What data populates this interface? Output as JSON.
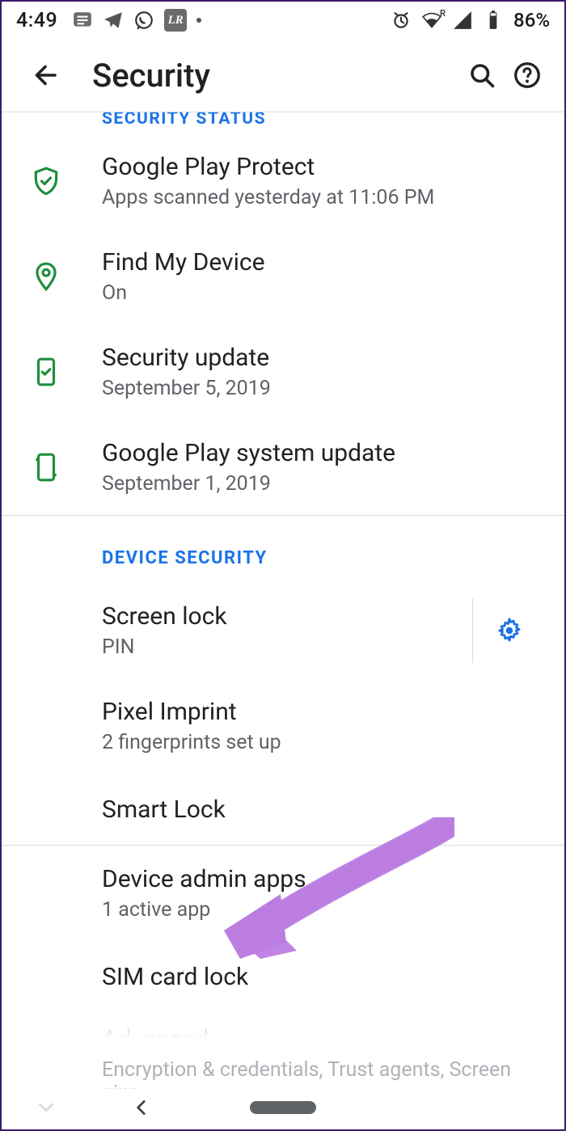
{
  "status": {
    "time": "4:49",
    "battery": "86%",
    "wifi_badge": "R"
  },
  "appbar": {
    "title": "Security"
  },
  "section_cut": "SECURITY STATUS",
  "rows": {
    "play_protect": {
      "title": "Google Play Protect",
      "subtitle": "Apps scanned yesterday at 11:06 PM"
    },
    "find_device": {
      "title": "Find My Device",
      "subtitle": "On"
    },
    "sec_update": {
      "title": "Security update",
      "subtitle": "September 5, 2019"
    },
    "sys_update": {
      "title": "Google Play system update",
      "subtitle": "September 1, 2019"
    }
  },
  "section2": "DEVICE SECURITY",
  "dev": {
    "screen_lock": {
      "title": "Screen lock",
      "subtitle": "PIN"
    },
    "imprint": {
      "title": "Pixel Imprint",
      "subtitle": "2 fingerprints set up"
    },
    "smart_lock": {
      "title": "Smart Lock"
    },
    "admin": {
      "title": "Device admin apps",
      "subtitle": "1 active app"
    },
    "sim": {
      "title": "SIM card lock"
    },
    "advanced": {
      "title": "Advanced",
      "subtitle": "Encryption & credentials, Trust agents, Screen pinn…"
    }
  }
}
